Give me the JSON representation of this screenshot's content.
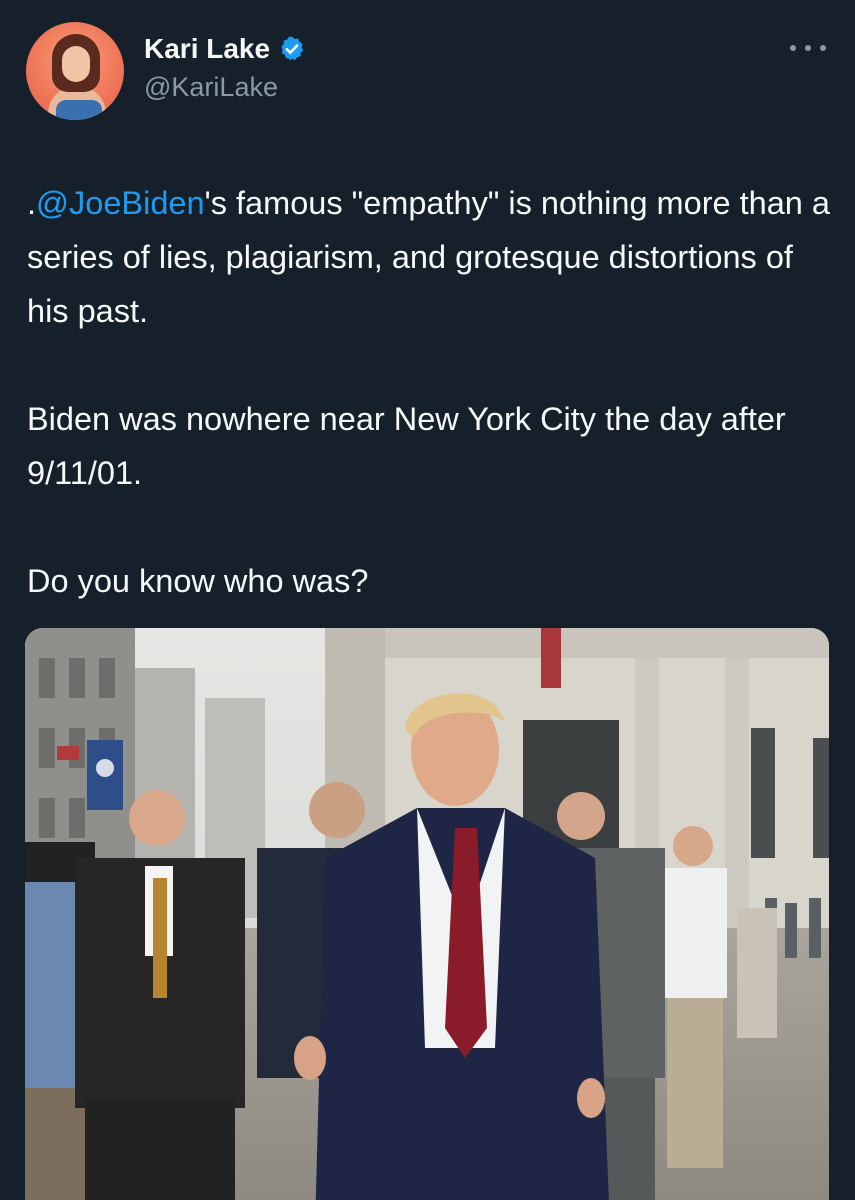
{
  "author": {
    "display_name": "Kari Lake",
    "handle": "@KariLake",
    "verified": true,
    "avatar_icon": "profile-photo"
  },
  "menu": {
    "icon": "more-horizontal-icon"
  },
  "tweet": {
    "paragraph1": {
      "prefix": ".",
      "mention": "@JoeBiden",
      "text": "'s famous \"empathy\" is nothing more than a series of lies, plagiarism, and grotesque distortions of his past."
    },
    "paragraph2": "Biden was nowhere near New York City the day after 9/11/01.",
    "paragraph3": "Do you know who was?"
  },
  "media": {
    "type": "photo",
    "scene": "street-photo"
  },
  "colors": {
    "background": "#15202b",
    "text": "#f7f9f9",
    "secondary": "#8b98a5",
    "link": "#1d9bf0",
    "verified": "#1d9bf0"
  }
}
